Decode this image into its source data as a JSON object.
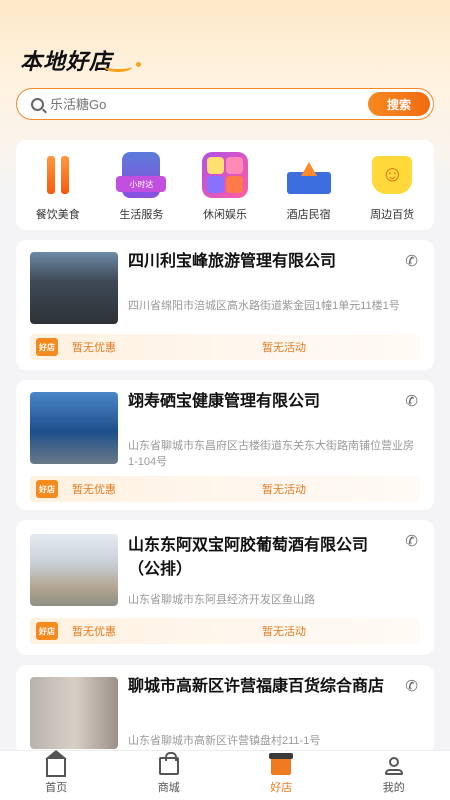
{
  "header": {
    "title": "本地好店"
  },
  "search": {
    "placeholder": "乐活糖Go",
    "button_label": "搜索"
  },
  "categories": [
    {
      "label": "餐饮美食",
      "icon": "fork-knife-icon"
    },
    {
      "label": "生活服务",
      "icon": "phone-shop-icon",
      "tag": "小时达"
    },
    {
      "label": "休闲娱乐",
      "icon": "leisure-icon"
    },
    {
      "label": "酒店民宿",
      "icon": "castle-icon"
    },
    {
      "label": "周边百货",
      "icon": "smiley-bag-icon"
    }
  ],
  "shops": [
    {
      "name": "四川利宝峰旅游管理有限公司",
      "address": "四川省绵阳市涪城区高水路街道紫金园1幢1单元11楼1号",
      "badge": "好店",
      "promo_left": "暂无优惠",
      "promo_right": "暂无活动"
    },
    {
      "name": "翊寿硒宝健康管理有限公司",
      "address": "山东省聊城市东昌府区古楼街道东关东大街路南铺位营业房1-104号",
      "badge": "好店",
      "promo_left": "暂无优惠",
      "promo_right": "暂无活动"
    },
    {
      "name": "山东东阿双宝阿胶葡萄酒有限公司（公排）",
      "address": "山东省聊城市东阿县经济开发区鱼山路",
      "badge": "好店",
      "promo_left": "暂无优惠",
      "promo_right": "暂无活动"
    },
    {
      "name": "聊城市高新区许营福康百货综合商店",
      "address": "山东省聊城市高新区许营镇盘村211-1号"
    }
  ],
  "tabbar": [
    {
      "label": "首页",
      "icon": "home-icon",
      "active": false
    },
    {
      "label": "商城",
      "icon": "shopping-bag-icon",
      "active": false
    },
    {
      "label": "好店",
      "icon": "store-icon",
      "active": true
    },
    {
      "label": "我的",
      "icon": "user-icon",
      "active": false
    }
  ],
  "colors": {
    "accent": "#f07a1f",
    "header_bg": "#fde9c8"
  }
}
